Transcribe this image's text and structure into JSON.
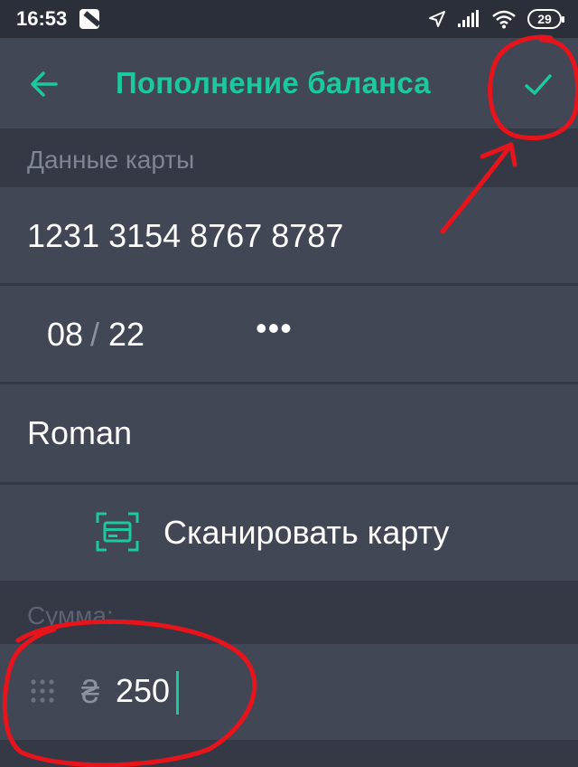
{
  "status_bar": {
    "time": "16:53",
    "battery": "29",
    "icons": [
      "app-notification-icon",
      "location-arrow-icon",
      "signal-icon",
      "wifi-icon",
      "battery-icon"
    ]
  },
  "header": {
    "title": "Пополнение баланса",
    "back_icon": "arrow-left-icon",
    "confirm_icon": "checkmark-icon"
  },
  "card_section": {
    "label": "Данные карты",
    "number": "1231 3154 8767 8787",
    "expiry_month": "08",
    "expiry_separator": "/",
    "expiry_year": "22",
    "cvv_mask": "•••",
    "holder": "Roman"
  },
  "scan": {
    "label": "Сканировать карту",
    "icon": "card-scan-icon"
  },
  "amount_section": {
    "label": "Сумма:",
    "currency_symbol": "₴",
    "value": "250",
    "icon": "keypad-grip-icon"
  },
  "colors": {
    "accent": "#1cc8a0",
    "background": "#353946",
    "surface": "#424756",
    "annotation": "#e8141c"
  }
}
